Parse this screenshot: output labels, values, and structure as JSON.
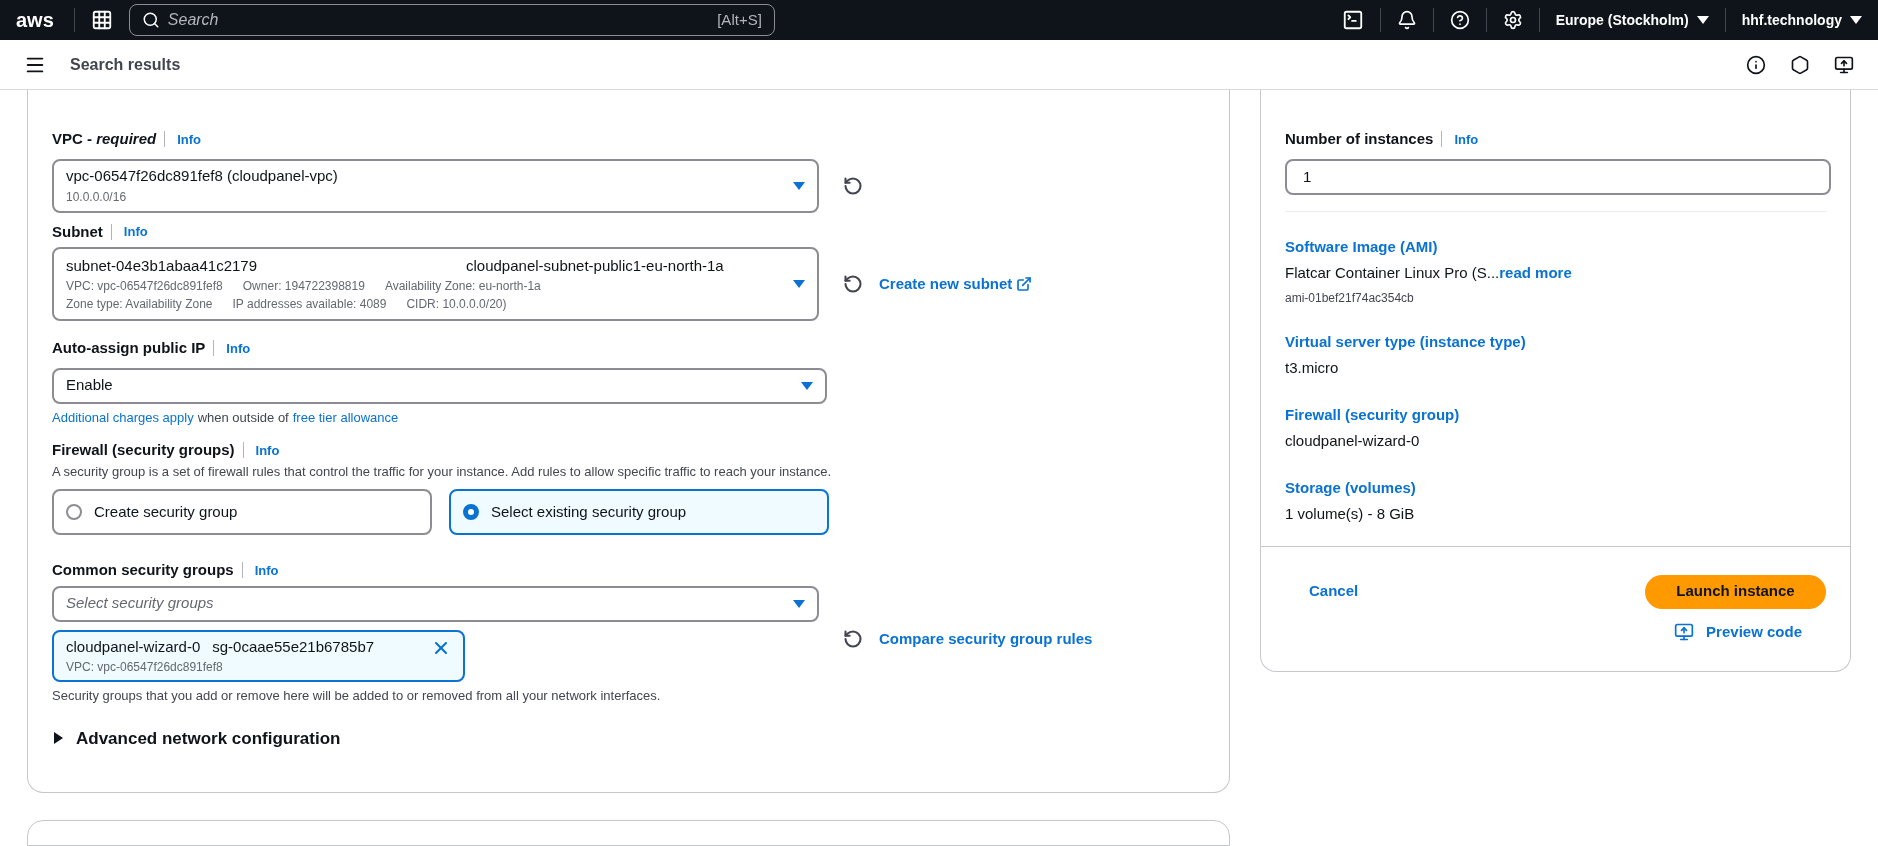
{
  "topbar": {
    "logo": "aws",
    "search": {
      "placeholder": "Search",
      "shortcut": "[Alt+S]"
    },
    "region": "Europe (Stockholm)",
    "account": "hhf.technology"
  },
  "subbar": {
    "title": "Search results"
  },
  "network": {
    "vpc": {
      "label": "VPC - ",
      "label_em": "required",
      "info": "Info",
      "value": "vpc-06547f26dc891fef8 (cloudpanel-vpc)",
      "detail": "10.0.0.0/16"
    },
    "subnet": {
      "label": "Subnet",
      "info": "Info",
      "value": "subnet-04e3b1abaa41c2179",
      "name": "cloudpanel-subnet-public1-eu-north-1a",
      "details": [
        [
          "VPC: vpc-06547f26dc891fef8",
          "Owner: 194722398819",
          "Availability Zone: eu-north-1a"
        ],
        [
          "Zone type: Availability Zone",
          "IP addresses available: 4089",
          "CIDR: 10.0.0.0/20)"
        ]
      ],
      "create_link": "Create new subnet"
    },
    "public_ip": {
      "label": "Auto-assign public IP",
      "info": "Info",
      "value": "Enable",
      "note_link1": "Additional charges apply",
      "note_text": "when outside of",
      "note_link2": "free tier allowance"
    },
    "firewall": {
      "label": "Firewall (security groups)",
      "info": "Info",
      "description": "A security group is a set of firewall rules that control the traffic for your instance. Add rules to allow specific traffic to reach your instance.",
      "options": [
        {
          "label": "Create security group",
          "selected": false
        },
        {
          "label": "Select existing security group",
          "selected": true
        }
      ]
    },
    "common_groups": {
      "label": "Common security groups",
      "info": "Info",
      "placeholder": "Select security groups",
      "compare_link": "Compare security group rules",
      "tokens": [
        {
          "name": "cloudpanel-wizard-0",
          "id": "sg-0caae55e21b6785b7",
          "vpc": "VPC: vpc-06547f26dc891fef8"
        }
      ],
      "hint": "Security groups that you add or remove here will be added to or removed from all your network interfaces."
    },
    "advanced": {
      "label": "Advanced network configuration",
      "expanded": false
    }
  },
  "summary": {
    "instances": {
      "label": "Number of instances",
      "info": "Info",
      "value": "1"
    },
    "items": [
      {
        "title": "Software Image (AMI)",
        "value": "Flatcar Container Linux Pro (S...",
        "link": "read more",
        "sub": "ami-01bef21f74ac354cb"
      },
      {
        "title": "Virtual server type (instance type)",
        "value": "t3.micro"
      },
      {
        "title": "Firewall (security group)",
        "value": "cloudpanel-wizard-0"
      },
      {
        "title": "Storage (volumes)",
        "value": "1 volume(s) - 8 GiB"
      }
    ],
    "cancel": "Cancel",
    "launch": "Launch instance",
    "preview": "Preview code"
  }
}
